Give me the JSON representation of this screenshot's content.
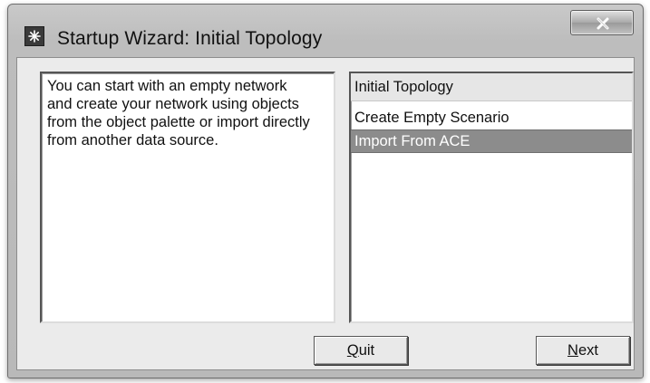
{
  "window": {
    "title": "Startup Wizard: Initial Topology",
    "app_icon": "wizard-star-icon",
    "close_icon": "close-x-icon"
  },
  "description": {
    "text": "You can start with an empty network\nand create your network using objects\nfrom the object palette or import directly\nfrom another data source."
  },
  "topology_list": {
    "header": "Initial Topology",
    "items": [
      {
        "label": "Create Empty Scenario",
        "selected": false
      },
      {
        "label": "Import From ACE",
        "selected": true
      }
    ]
  },
  "buttons": {
    "quit": {
      "accel": "Q",
      "rest": "uit"
    },
    "next": {
      "accel": "N",
      "rest": "ext"
    }
  },
  "colors": {
    "selection": "#8c8c8c",
    "chrome": "#bdbdbd",
    "dialog_bg": "#ebebeb"
  }
}
